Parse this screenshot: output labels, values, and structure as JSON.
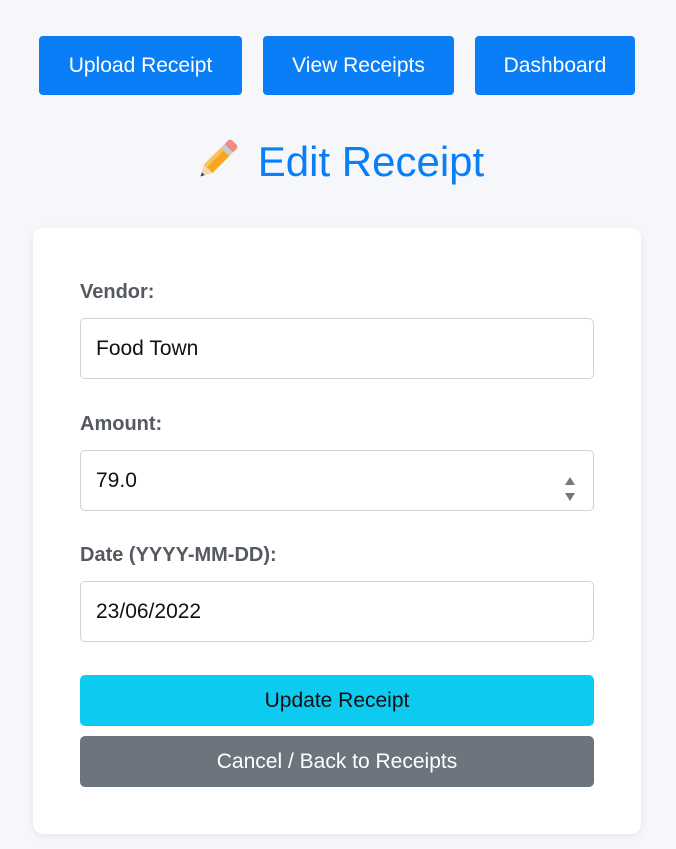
{
  "nav": {
    "items": [
      {
        "label": "Upload Receipt"
      },
      {
        "label": "View Receipts"
      },
      {
        "label": "Dashboard"
      }
    ]
  },
  "page": {
    "title": "Edit Receipt",
    "title_icon": "pencil-icon"
  },
  "form": {
    "vendor": {
      "label": "Vendor:",
      "value": "Food Town"
    },
    "amount": {
      "label": "Amount:",
      "value": "79.0"
    },
    "date": {
      "label": "Date (YYYY-MM-DD):",
      "value": "23/06/2022"
    },
    "update_label": "Update Receipt",
    "cancel_label": "Cancel / Back to Receipts"
  },
  "colors": {
    "primary": "#0a7ef7",
    "info": "#0dcaf0",
    "secondary": "#6c757d",
    "background": "#f5f7fa"
  }
}
